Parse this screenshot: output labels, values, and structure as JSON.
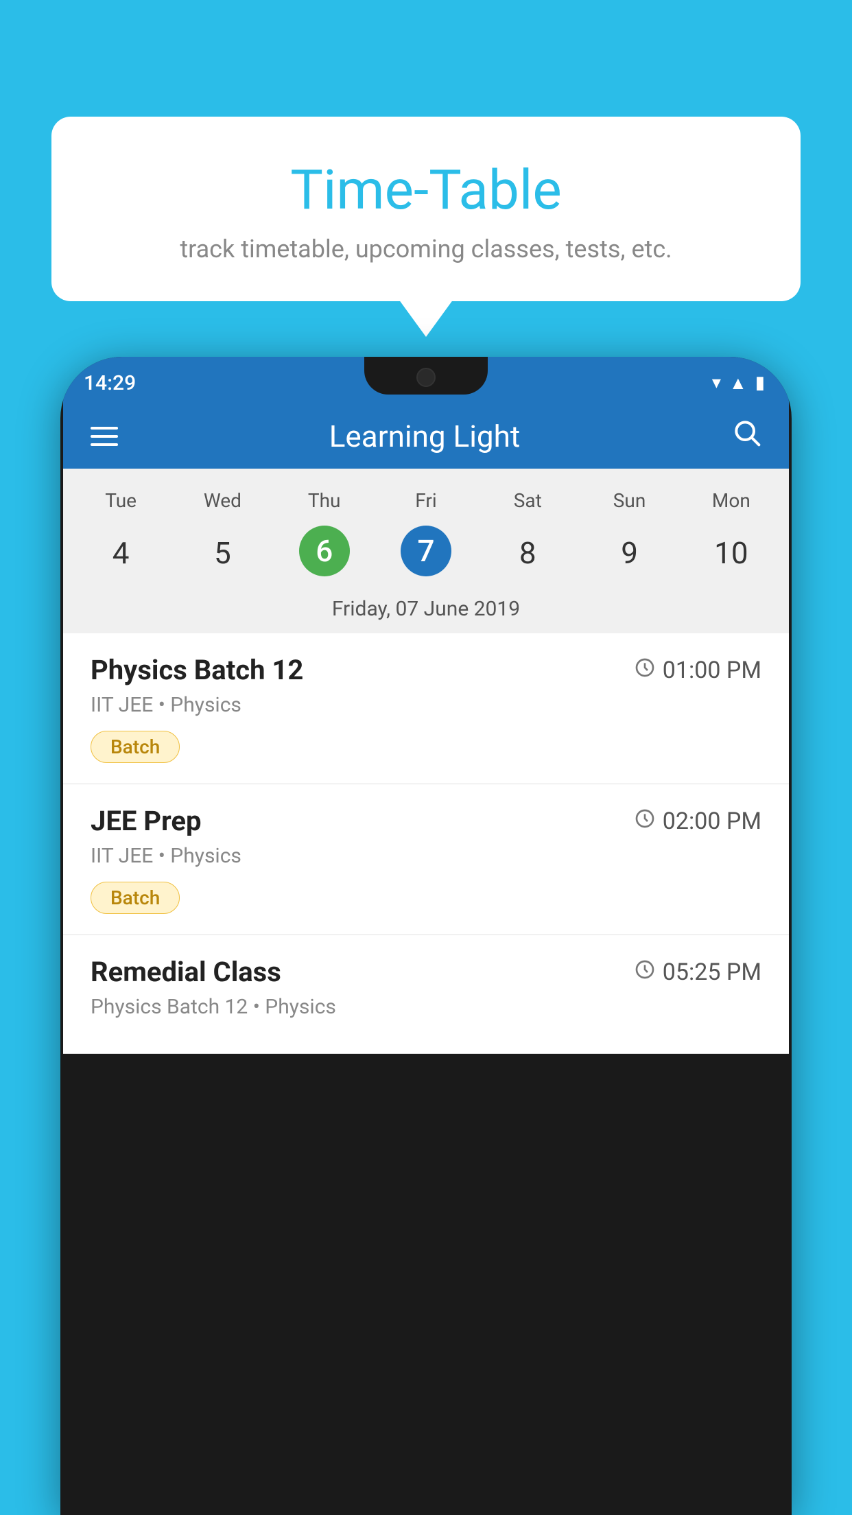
{
  "background": {
    "color": "#2BBDE8"
  },
  "speech_bubble": {
    "title": "Time-Table",
    "subtitle": "track timetable, upcoming classes, tests, etc."
  },
  "phone": {
    "status_bar": {
      "time": "14:29"
    },
    "app_bar": {
      "title": "Learning Light"
    },
    "calendar": {
      "days": [
        {
          "label": "Tue",
          "number": "4"
        },
        {
          "label": "Wed",
          "number": "5"
        },
        {
          "label": "Thu",
          "number": "6",
          "state": "today"
        },
        {
          "label": "Fri",
          "number": "7",
          "state": "selected"
        },
        {
          "label": "Sat",
          "number": "8"
        },
        {
          "label": "Sun",
          "number": "9"
        },
        {
          "label": "Mon",
          "number": "10"
        }
      ],
      "selected_date_label": "Friday, 07 June 2019"
    },
    "schedule": [
      {
        "title": "Physics Batch 12",
        "time": "01:00 PM",
        "subtitle": "IIT JEE • Physics",
        "badge": "Batch"
      },
      {
        "title": "JEE Prep",
        "time": "02:00 PM",
        "subtitle": "IIT JEE • Physics",
        "badge": "Batch"
      },
      {
        "title": "Remedial Class",
        "time": "05:25 PM",
        "subtitle": "Physics Batch 12 • Physics",
        "badge": null
      }
    ]
  }
}
